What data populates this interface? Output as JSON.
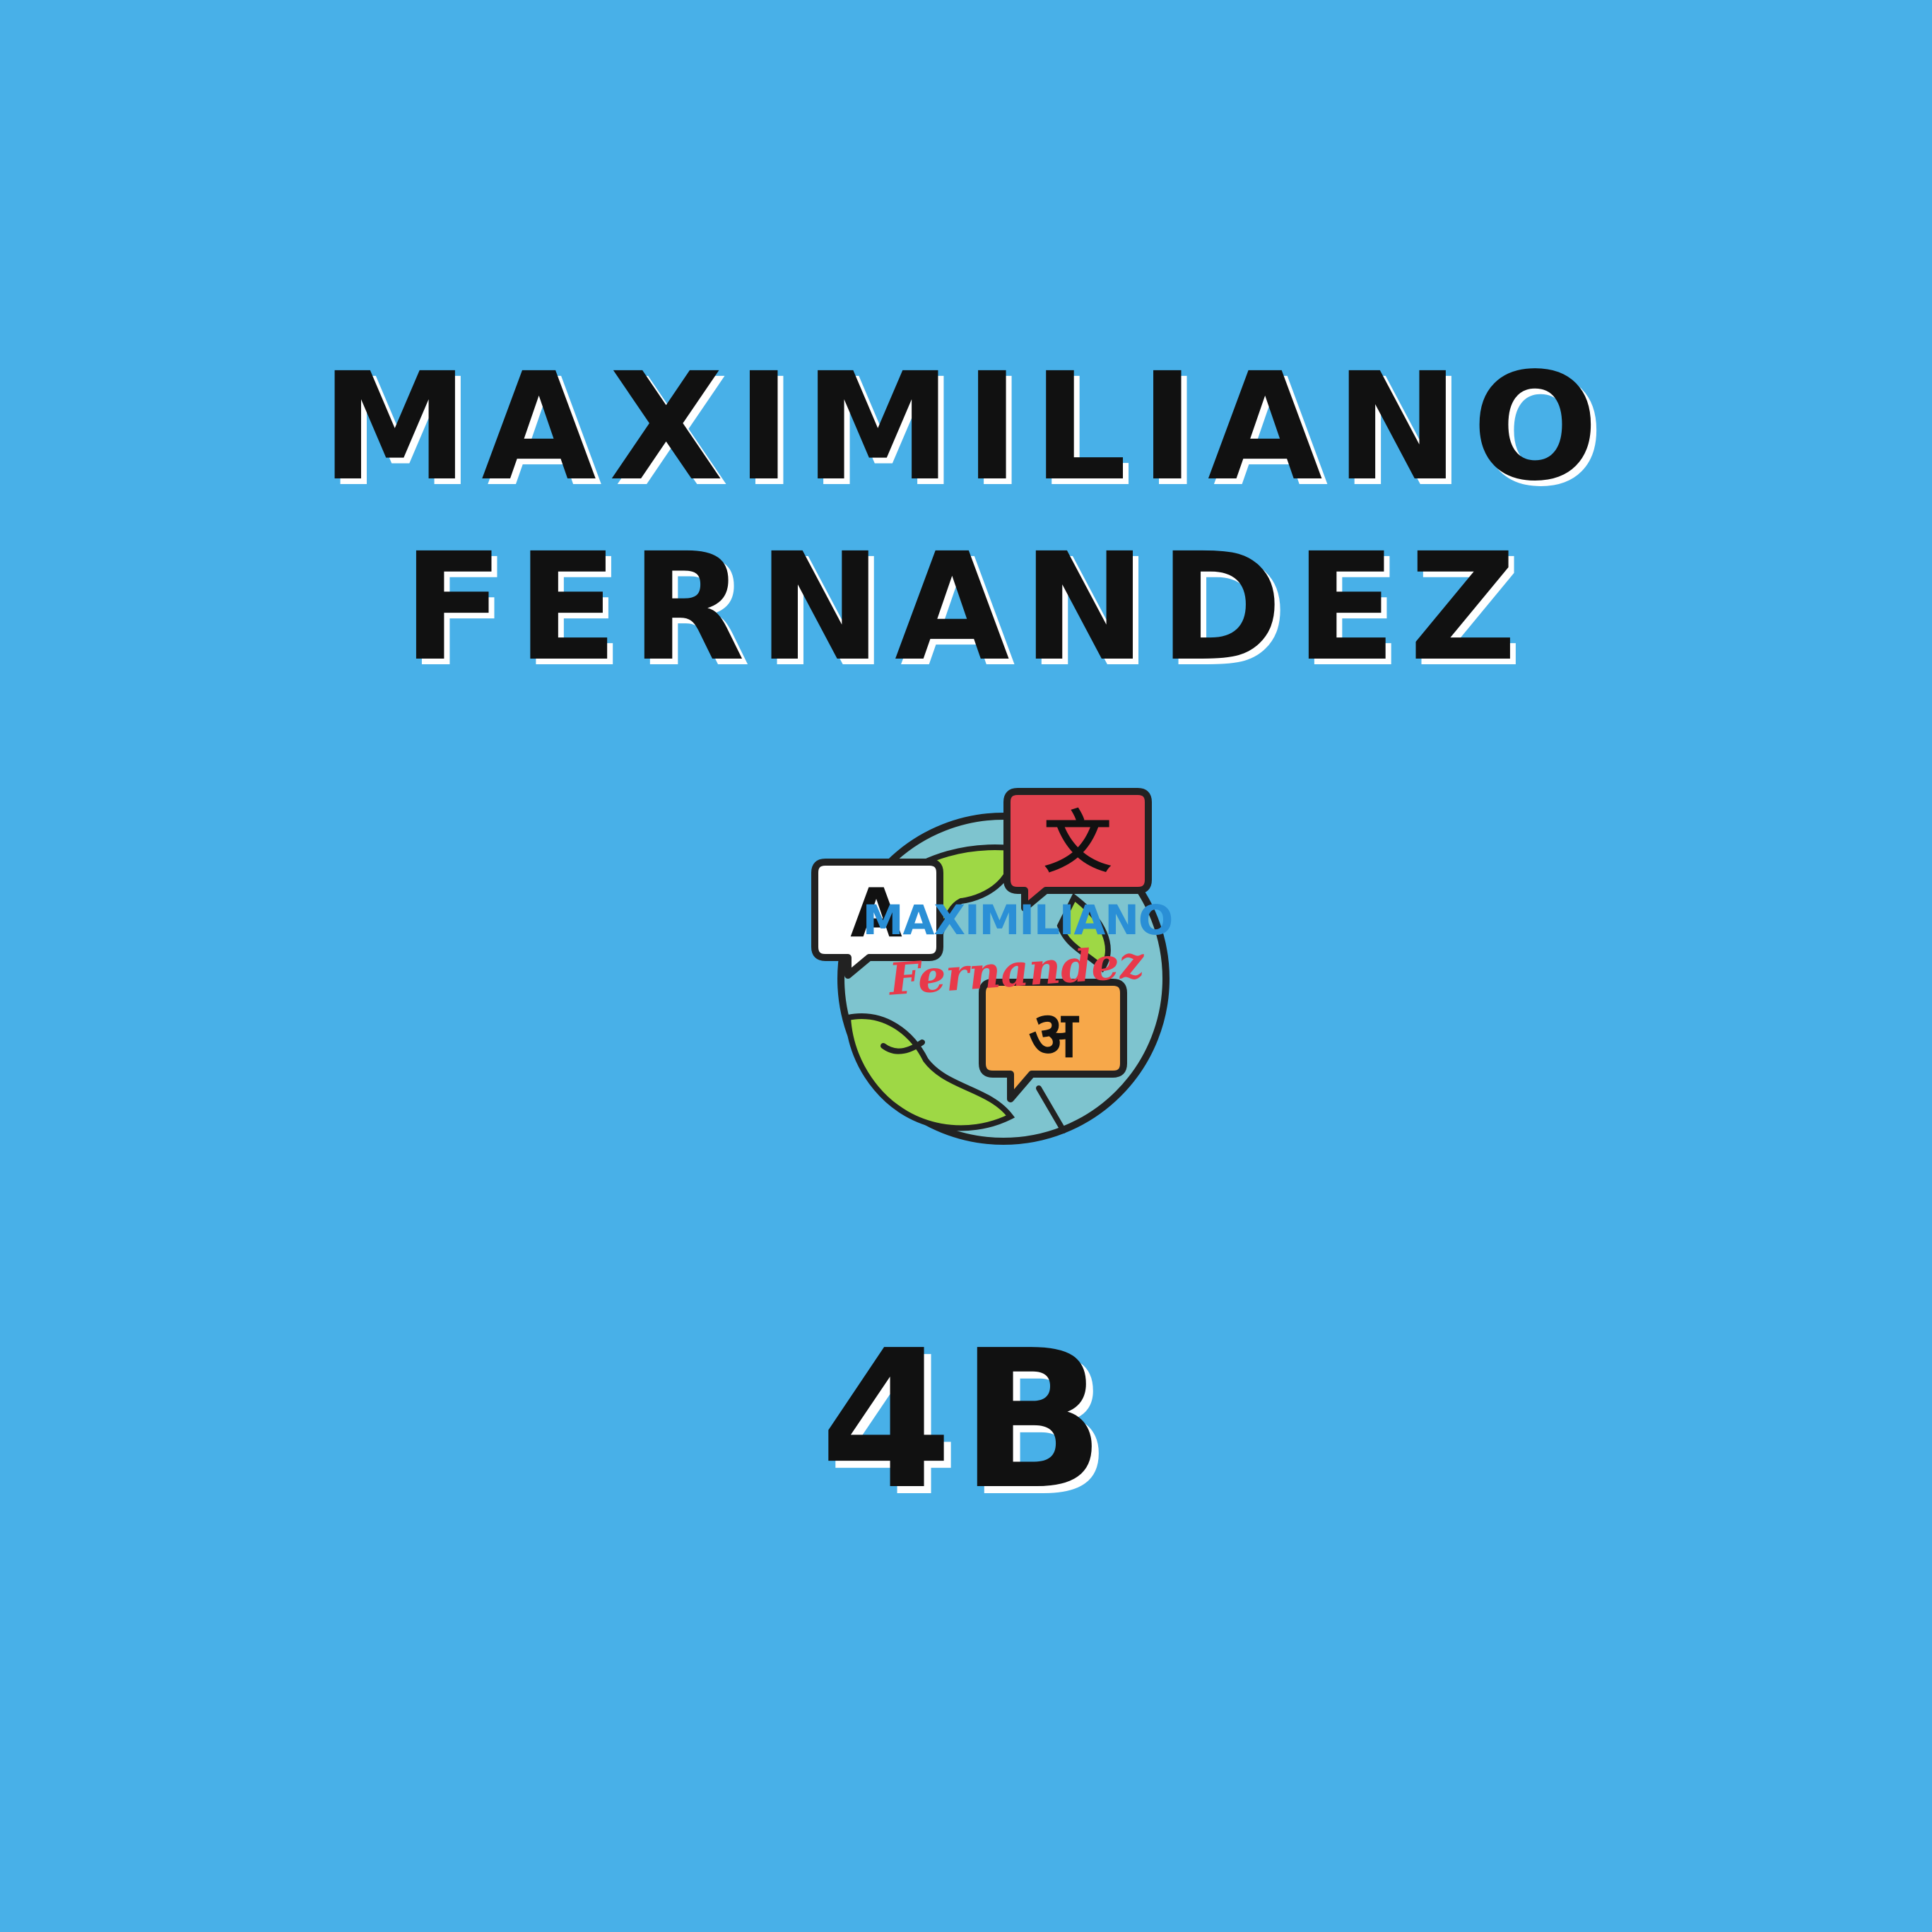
{
  "background_color": "#48B0E8",
  "title": {
    "line1": "MAXIMILIANO",
    "line2": "FERNANDEZ"
  },
  "logo": {
    "icon": "translation-globe-icon",
    "bubble_latin": "A",
    "bubble_chinese": "文",
    "bubble_hindi": "अ",
    "watermark_line1": "MAXIMILIANO",
    "watermark_line2": "Fernandez",
    "colors": {
      "globe_land": "#9ED845",
      "globe_water": "#7EC4CF",
      "bubble_red": "#E2434F",
      "bubble_orange": "#F7A84A",
      "bubble_white": "#FFFFFF",
      "outline": "#222222",
      "watermark_blue": "#2A8FD6",
      "watermark_red": "#E8394A"
    }
  },
  "class_label": "4B"
}
